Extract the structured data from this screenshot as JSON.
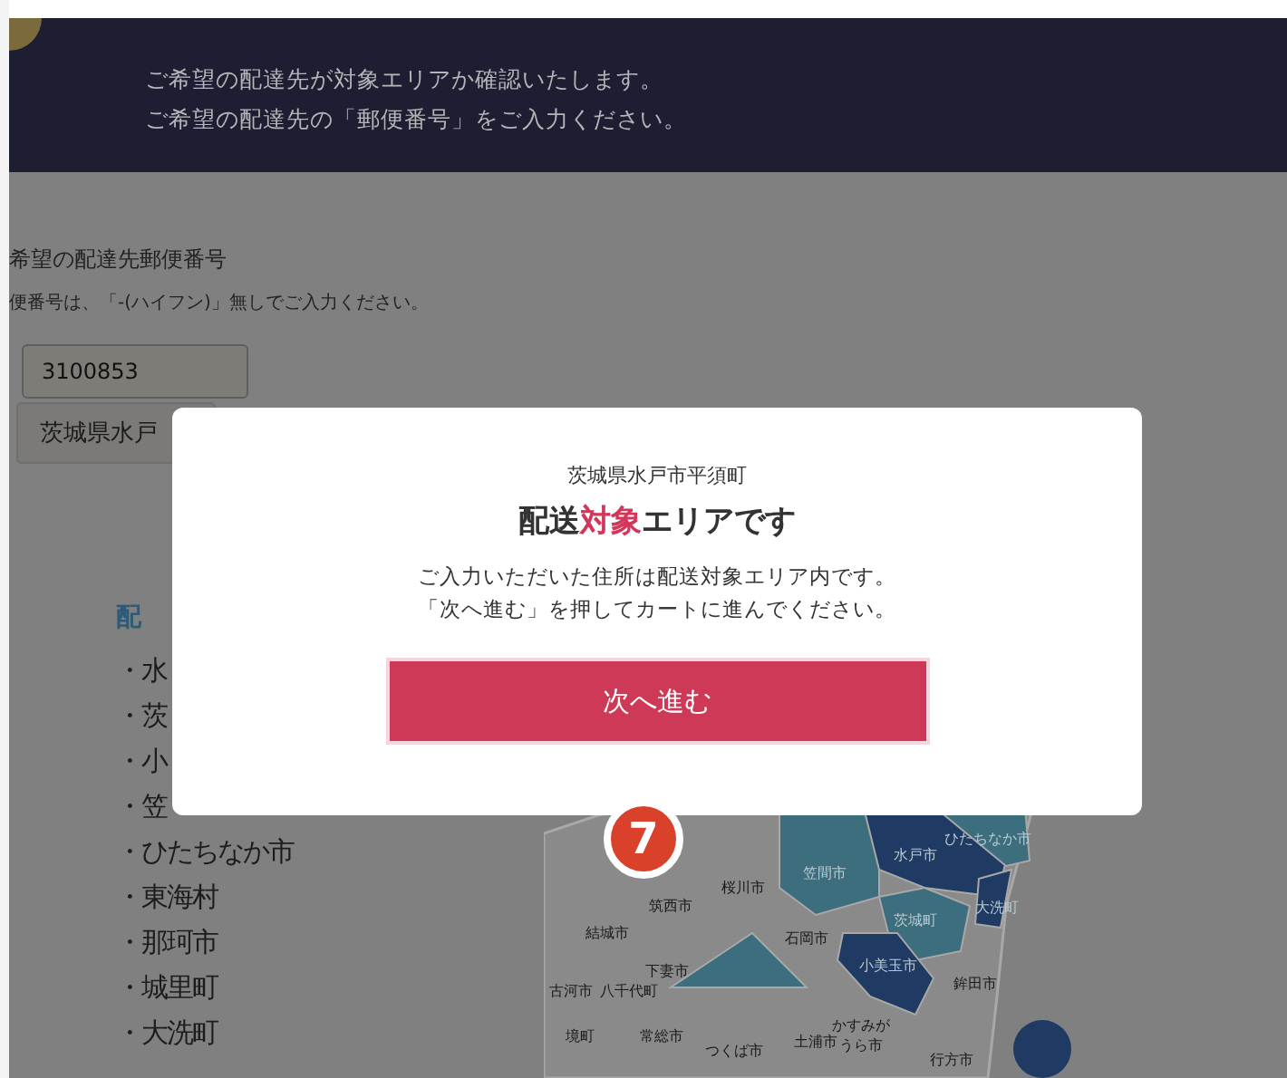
{
  "header": {
    "lines": [
      "ご希望の配達先が対象エリアか確認いたします。",
      "ご希望の配達先の「郵便番号」をご入力ください。"
    ]
  },
  "form": {
    "label": "希望の配達先郵便番号",
    "hint": "便番号は、「-(ハイフン)」無しでご入力ください。",
    "postal_code": "3100853",
    "address_button": "茨城県水戸"
  },
  "area_list": {
    "heading": "配",
    "items": [
      "・水",
      "・茨",
      "・小",
      "・笠",
      "・ひたちなか市",
      "・東海村",
      "・那珂市",
      "・城里町",
      "・大洗町"
    ]
  },
  "map": {
    "labels": [
      {
        "text": "ひたちなか市",
        "kind": "target"
      },
      {
        "text": "水戸市",
        "kind": "target"
      },
      {
        "text": "笠間市",
        "kind": "target"
      },
      {
        "text": "桜川市",
        "kind": "plain"
      },
      {
        "text": "筑西市",
        "kind": "plain"
      },
      {
        "text": "結城市",
        "kind": "plain"
      },
      {
        "text": "石岡市",
        "kind": "plain"
      },
      {
        "text": "茨城町",
        "kind": "target"
      },
      {
        "text": "大洗町",
        "kind": "target"
      },
      {
        "text": "下妻市",
        "kind": "plain"
      },
      {
        "text": "小美玉市",
        "kind": "target"
      },
      {
        "text": "古河市",
        "kind": "plain"
      },
      {
        "text": "八千代町",
        "kind": "plain"
      },
      {
        "text": "鉾田市",
        "kind": "plain"
      },
      {
        "text": "境町",
        "kind": "plain"
      },
      {
        "text": "常総市",
        "kind": "plain"
      },
      {
        "text": "つくば市",
        "kind": "plain"
      },
      {
        "text": "土浦市",
        "kind": "plain"
      },
      {
        "text": "かすみが",
        "kind": "plain"
      },
      {
        "text": "うら市",
        "kind": "plain"
      },
      {
        "text": "行方市",
        "kind": "plain"
      }
    ]
  },
  "step_badge": "7",
  "modal": {
    "address": "茨城県水戸市平須町",
    "title": "配送**対象**エリアです",
    "message": [
      "ご入力いただいた住所は配送対象エリア内です。",
      "「次へ進む」を押してカートに進んでください。"
    ],
    "button": "次へ進む"
  }
}
